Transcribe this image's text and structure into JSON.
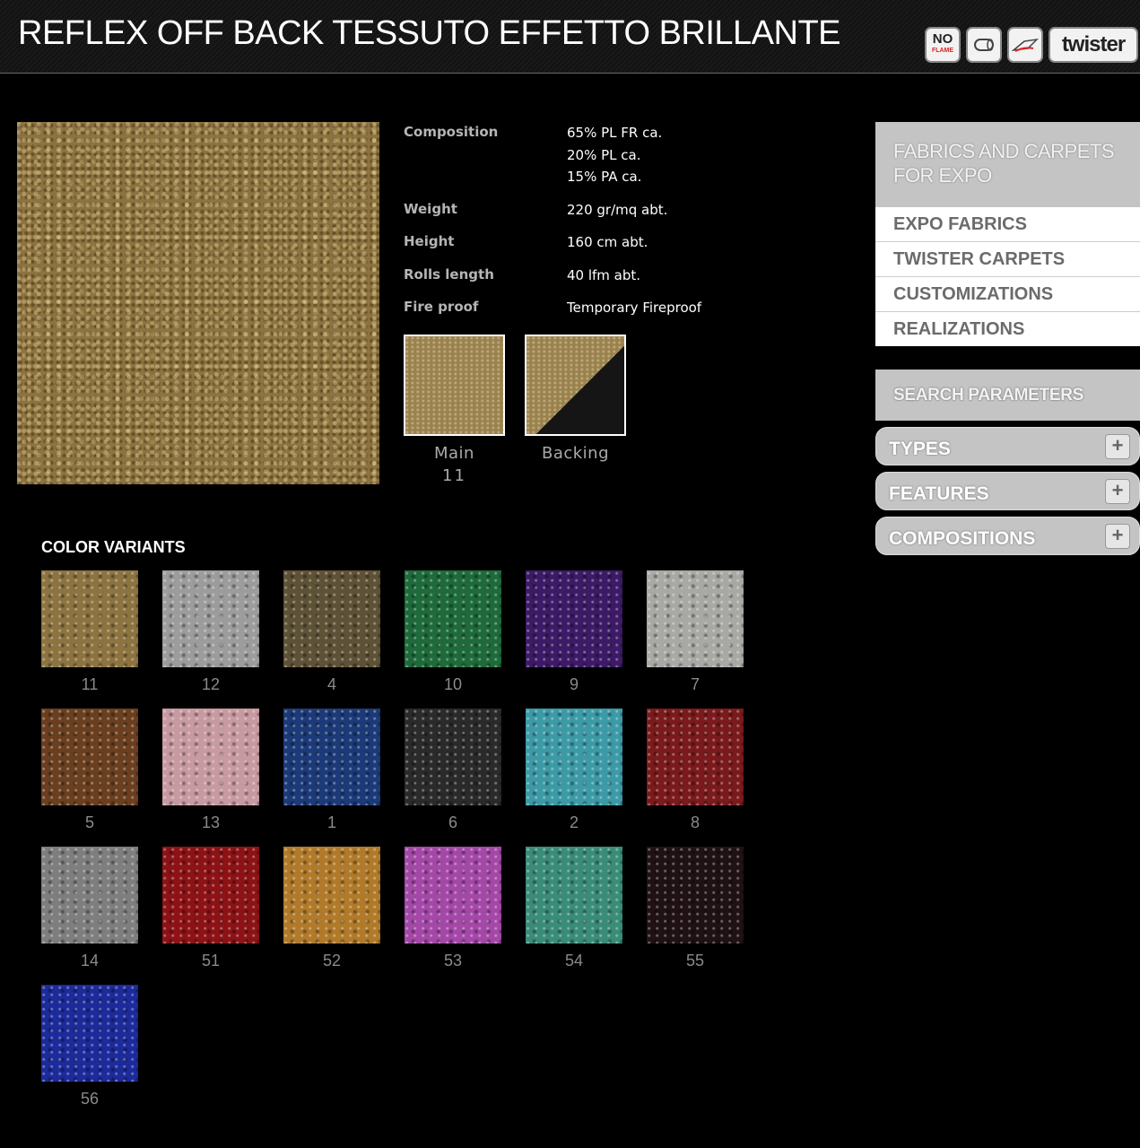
{
  "header": {
    "title": "REFLEX OFF BACK TESSUTO EFFETTO BRILLANTE",
    "badges": {
      "noflame_top": "NO",
      "noflame_bottom": "FLAME",
      "twister": "twister"
    }
  },
  "specs": {
    "composition_label": "Composition",
    "composition_values": [
      "65% PL FR ca.",
      "20% PL ca.",
      "15% PA ca."
    ],
    "weight_label": "Weight",
    "weight_value": "220 gr/mq abt.",
    "height_label": "Height",
    "height_value": "160 cm abt.",
    "rolls_label": "Rolls length",
    "rolls_value": "40 lfm abt.",
    "fire_label": "Fire proof",
    "fire_value": "Temporary Fireproof"
  },
  "thumbs": {
    "main_label": "Main",
    "main_code": "11",
    "backing_label": "Backing"
  },
  "color_variants": {
    "title": "COLOR VARIANTS",
    "items": [
      {
        "code": "11",
        "color": "#8c7340"
      },
      {
        "code": "12",
        "color": "#9c9c9c"
      },
      {
        "code": "4",
        "color": "#5e5236"
      },
      {
        "code": "10",
        "color": "#1e6a3a"
      },
      {
        "code": "9",
        "color": "#3c1a66"
      },
      {
        "code": "7",
        "color": "#a8a8a4"
      },
      {
        "code": "5",
        "color": "#6a3f1f"
      },
      {
        "code": "13",
        "color": "#c79aa1"
      },
      {
        "code": "1",
        "color": "#1c3a78"
      },
      {
        "code": "6",
        "color": "#2a2a2a"
      },
      {
        "code": "2",
        "color": "#3c9aa6"
      },
      {
        "code": "8",
        "color": "#7a1a1c"
      },
      {
        "code": "14",
        "color": "#7e7e7e"
      },
      {
        "code": "51",
        "color": "#8c1216"
      },
      {
        "code": "52",
        "color": "#b07a2a"
      },
      {
        "code": "53",
        "color": "#a448a8"
      },
      {
        "code": "54",
        "color": "#3a8c78"
      },
      {
        "code": "55",
        "color": "#201214"
      },
      {
        "code": "56",
        "color": "#1c2a9a"
      }
    ]
  },
  "sidebar": {
    "head": "FABRICS AND CARPETS FOR EXPO",
    "menu": [
      "EXPO FABRICS",
      "TWISTER CARPETS",
      "CUSTOMIZATIONS",
      "REALIZATIONS"
    ],
    "search_head": "SEARCH PARAMETERS",
    "filters": [
      "TYPES",
      "FEATURES",
      "COMPOSITIONS"
    ]
  }
}
